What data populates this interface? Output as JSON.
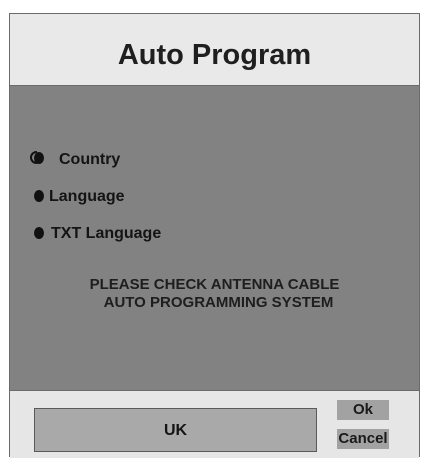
{
  "dialog": {
    "title": "Auto Program"
  },
  "menu": {
    "items": [
      {
        "label": "Country",
        "icon": "active-bullet-icon"
      },
      {
        "label": "Language",
        "icon": "bullet-icon"
      },
      {
        "label": "TXT Language",
        "icon": "bullet-icon"
      }
    ]
  },
  "message": {
    "line1": "PLEASE CHECK ANTENNA CABLE",
    "line2": "AUTO PROGRAMMING SYSTEM"
  },
  "footer": {
    "selected_value": "UK",
    "ok_label": "Ok",
    "cancel_label": "Cancel"
  },
  "colors": {
    "header_bg": "#e9e9e9",
    "body_bg": "#828282",
    "value_box_bg": "#a9a9a9",
    "button_bg": "#a2a2a2"
  }
}
